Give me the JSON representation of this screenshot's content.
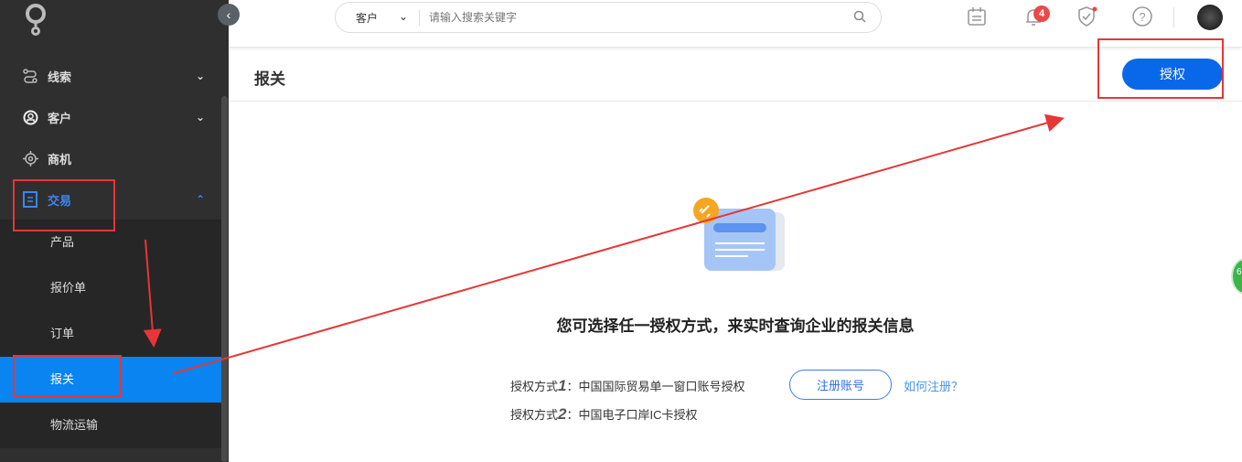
{
  "sidebar": {
    "items": [
      {
        "label": "线索",
        "icon": "route-icon",
        "expanded": false
      },
      {
        "label": "客户",
        "icon": "customer-icon",
        "expanded": false
      },
      {
        "label": "商机",
        "icon": "target-icon"
      },
      {
        "label": "交易",
        "icon": "document-icon",
        "expanded": true
      }
    ],
    "subitems": [
      "产品",
      "报价单",
      "订单",
      "报关",
      "物流运输"
    ],
    "active": "报关"
  },
  "topbar": {
    "search_scope": "客户",
    "search_placeholder": "请输入搜索关键字",
    "notification_count": "4"
  },
  "header": {
    "title": "报关",
    "auth_button": "授权"
  },
  "main": {
    "message": "您可选择任一授权方式，来实时查询企业的报关信息",
    "methods": [
      {
        "prefix": "授权方式",
        "num": "1",
        "text": "：中国国际贸易单一窗口账号授权"
      },
      {
        "prefix": "授权方式",
        "num": "2",
        "text": "：中国电子口岸IC卡授权"
      }
    ],
    "register_button": "注册账号",
    "how_link": "如何注册？"
  },
  "floating": {
    "label": "6"
  },
  "colors": {
    "accent": "#0967ea",
    "active_nav": "#0a84f0",
    "annotation": "#e83535"
  }
}
